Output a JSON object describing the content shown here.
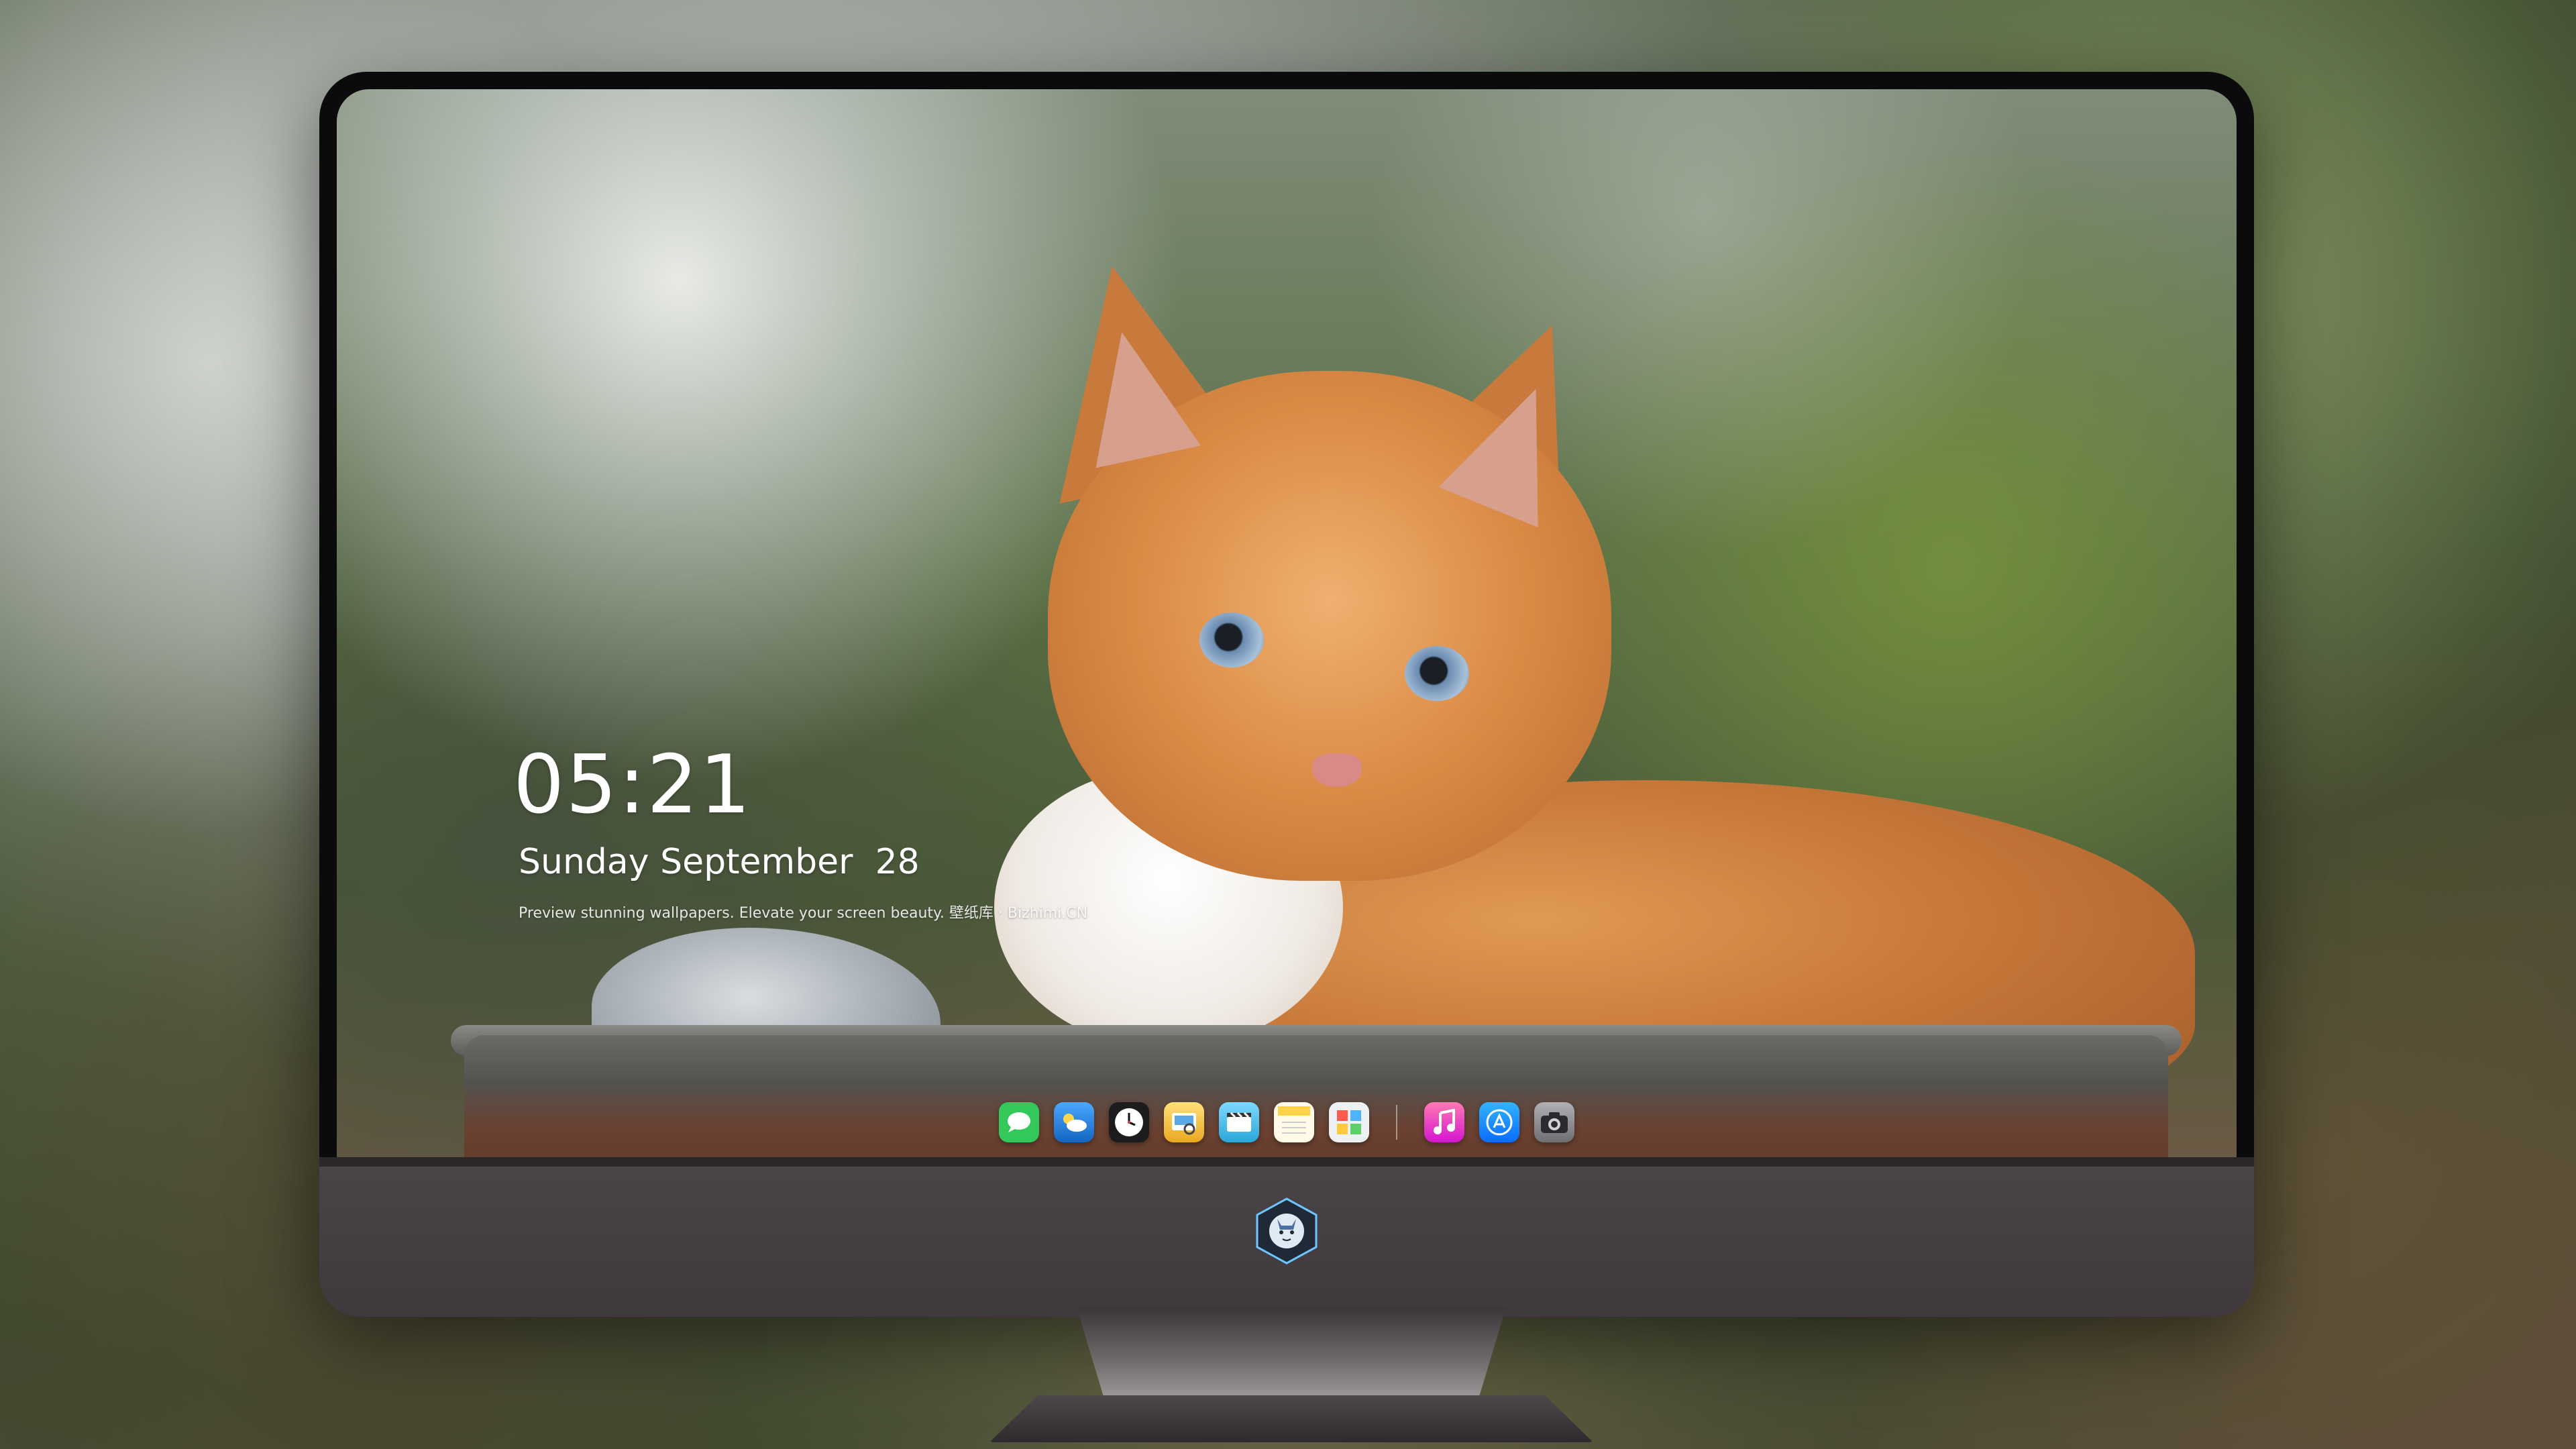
{
  "lock_screen": {
    "time": "05:21",
    "date": "Sunday September  28",
    "tagline": "Preview stunning wallpapers. Elevate your screen beauty. 壁纸库 · Bizhimi.CN"
  },
  "dock": {
    "apps": [
      {
        "name": "messages-icon",
        "color": "#34c759"
      },
      {
        "name": "weather-icon",
        "color": "#1e88e5"
      },
      {
        "name": "clock-icon",
        "color": "#1c1c1e"
      },
      {
        "name": "preview-icon",
        "color": "#f2c230"
      },
      {
        "name": "clips-icon",
        "color": "#5ac8fa"
      },
      {
        "name": "notes-icon",
        "color": "#ffd84d"
      },
      {
        "name": "photo-collage-icon",
        "color": "#e9eef2"
      },
      {
        "name": "music-icon",
        "color": "#ff3c8e"
      },
      {
        "name": "app-store-icon",
        "color": "#1a8cff"
      },
      {
        "name": "camera-icon",
        "color": "#8e8e93"
      }
    ]
  },
  "colors": {
    "bezel": "#0b0b0d",
    "chin": "#4a4448",
    "text": "#ffffff"
  }
}
